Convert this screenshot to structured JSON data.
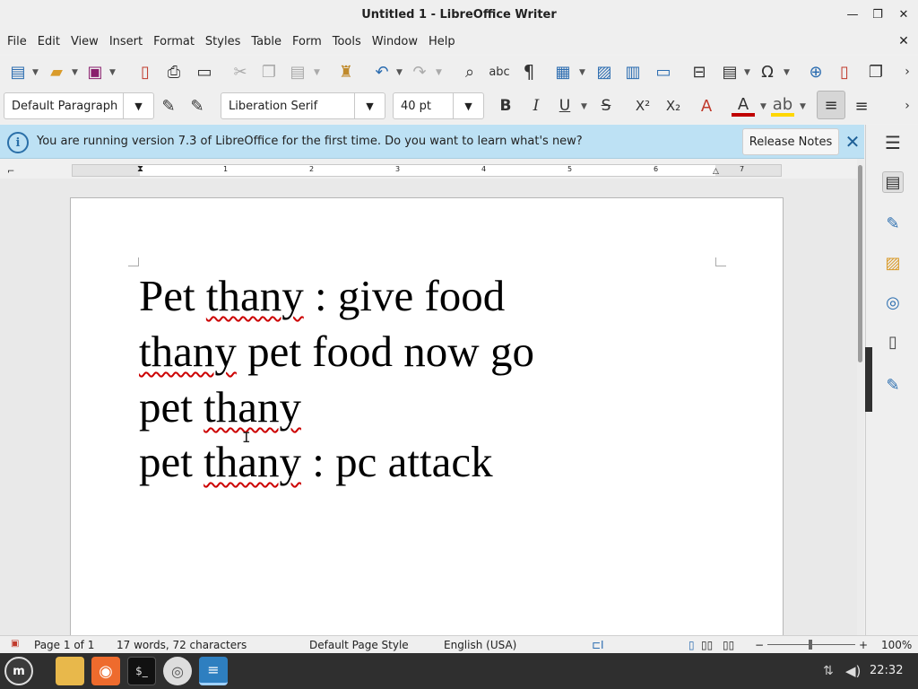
{
  "window": {
    "title": "Untitled 1 - LibreOffice Writer"
  },
  "menu": [
    "File",
    "Edit",
    "View",
    "Insert",
    "Format",
    "Styles",
    "Table",
    "Form",
    "Tools",
    "Window",
    "Help"
  ],
  "formatting": {
    "paragraph_style": "Default Paragraph",
    "font_name": "Liberation Serif",
    "font_size": "40 pt"
  },
  "infobar": {
    "message": "You are running version 7.3 of LibreOffice for the first time. Do you want to learn what's new?",
    "release_notes_label": "Release Notes"
  },
  "ruler": {
    "marks": [
      "1",
      "2",
      "3",
      "4",
      "5",
      "6",
      "7"
    ]
  },
  "document": {
    "lines": [
      [
        "Pet ",
        {
          "w": "thany",
          "sq": true
        },
        " : give food"
      ],
      [
        {
          "w": "thany",
          "sq": true
        },
        " pet food now go"
      ],
      [
        "pet ",
        {
          "w": "thany",
          "sq": true
        }
      ],
      [
        "pet ",
        {
          "w": "thany",
          "sq": true
        },
        " : pc attack"
      ]
    ]
  },
  "status": {
    "page": "Page 1 of 1",
    "words": "17 words, 72 characters",
    "page_style": "Default Page Style",
    "language": "English (USA)",
    "zoom": "100%"
  },
  "taskbar": {
    "clock": "22:32"
  }
}
